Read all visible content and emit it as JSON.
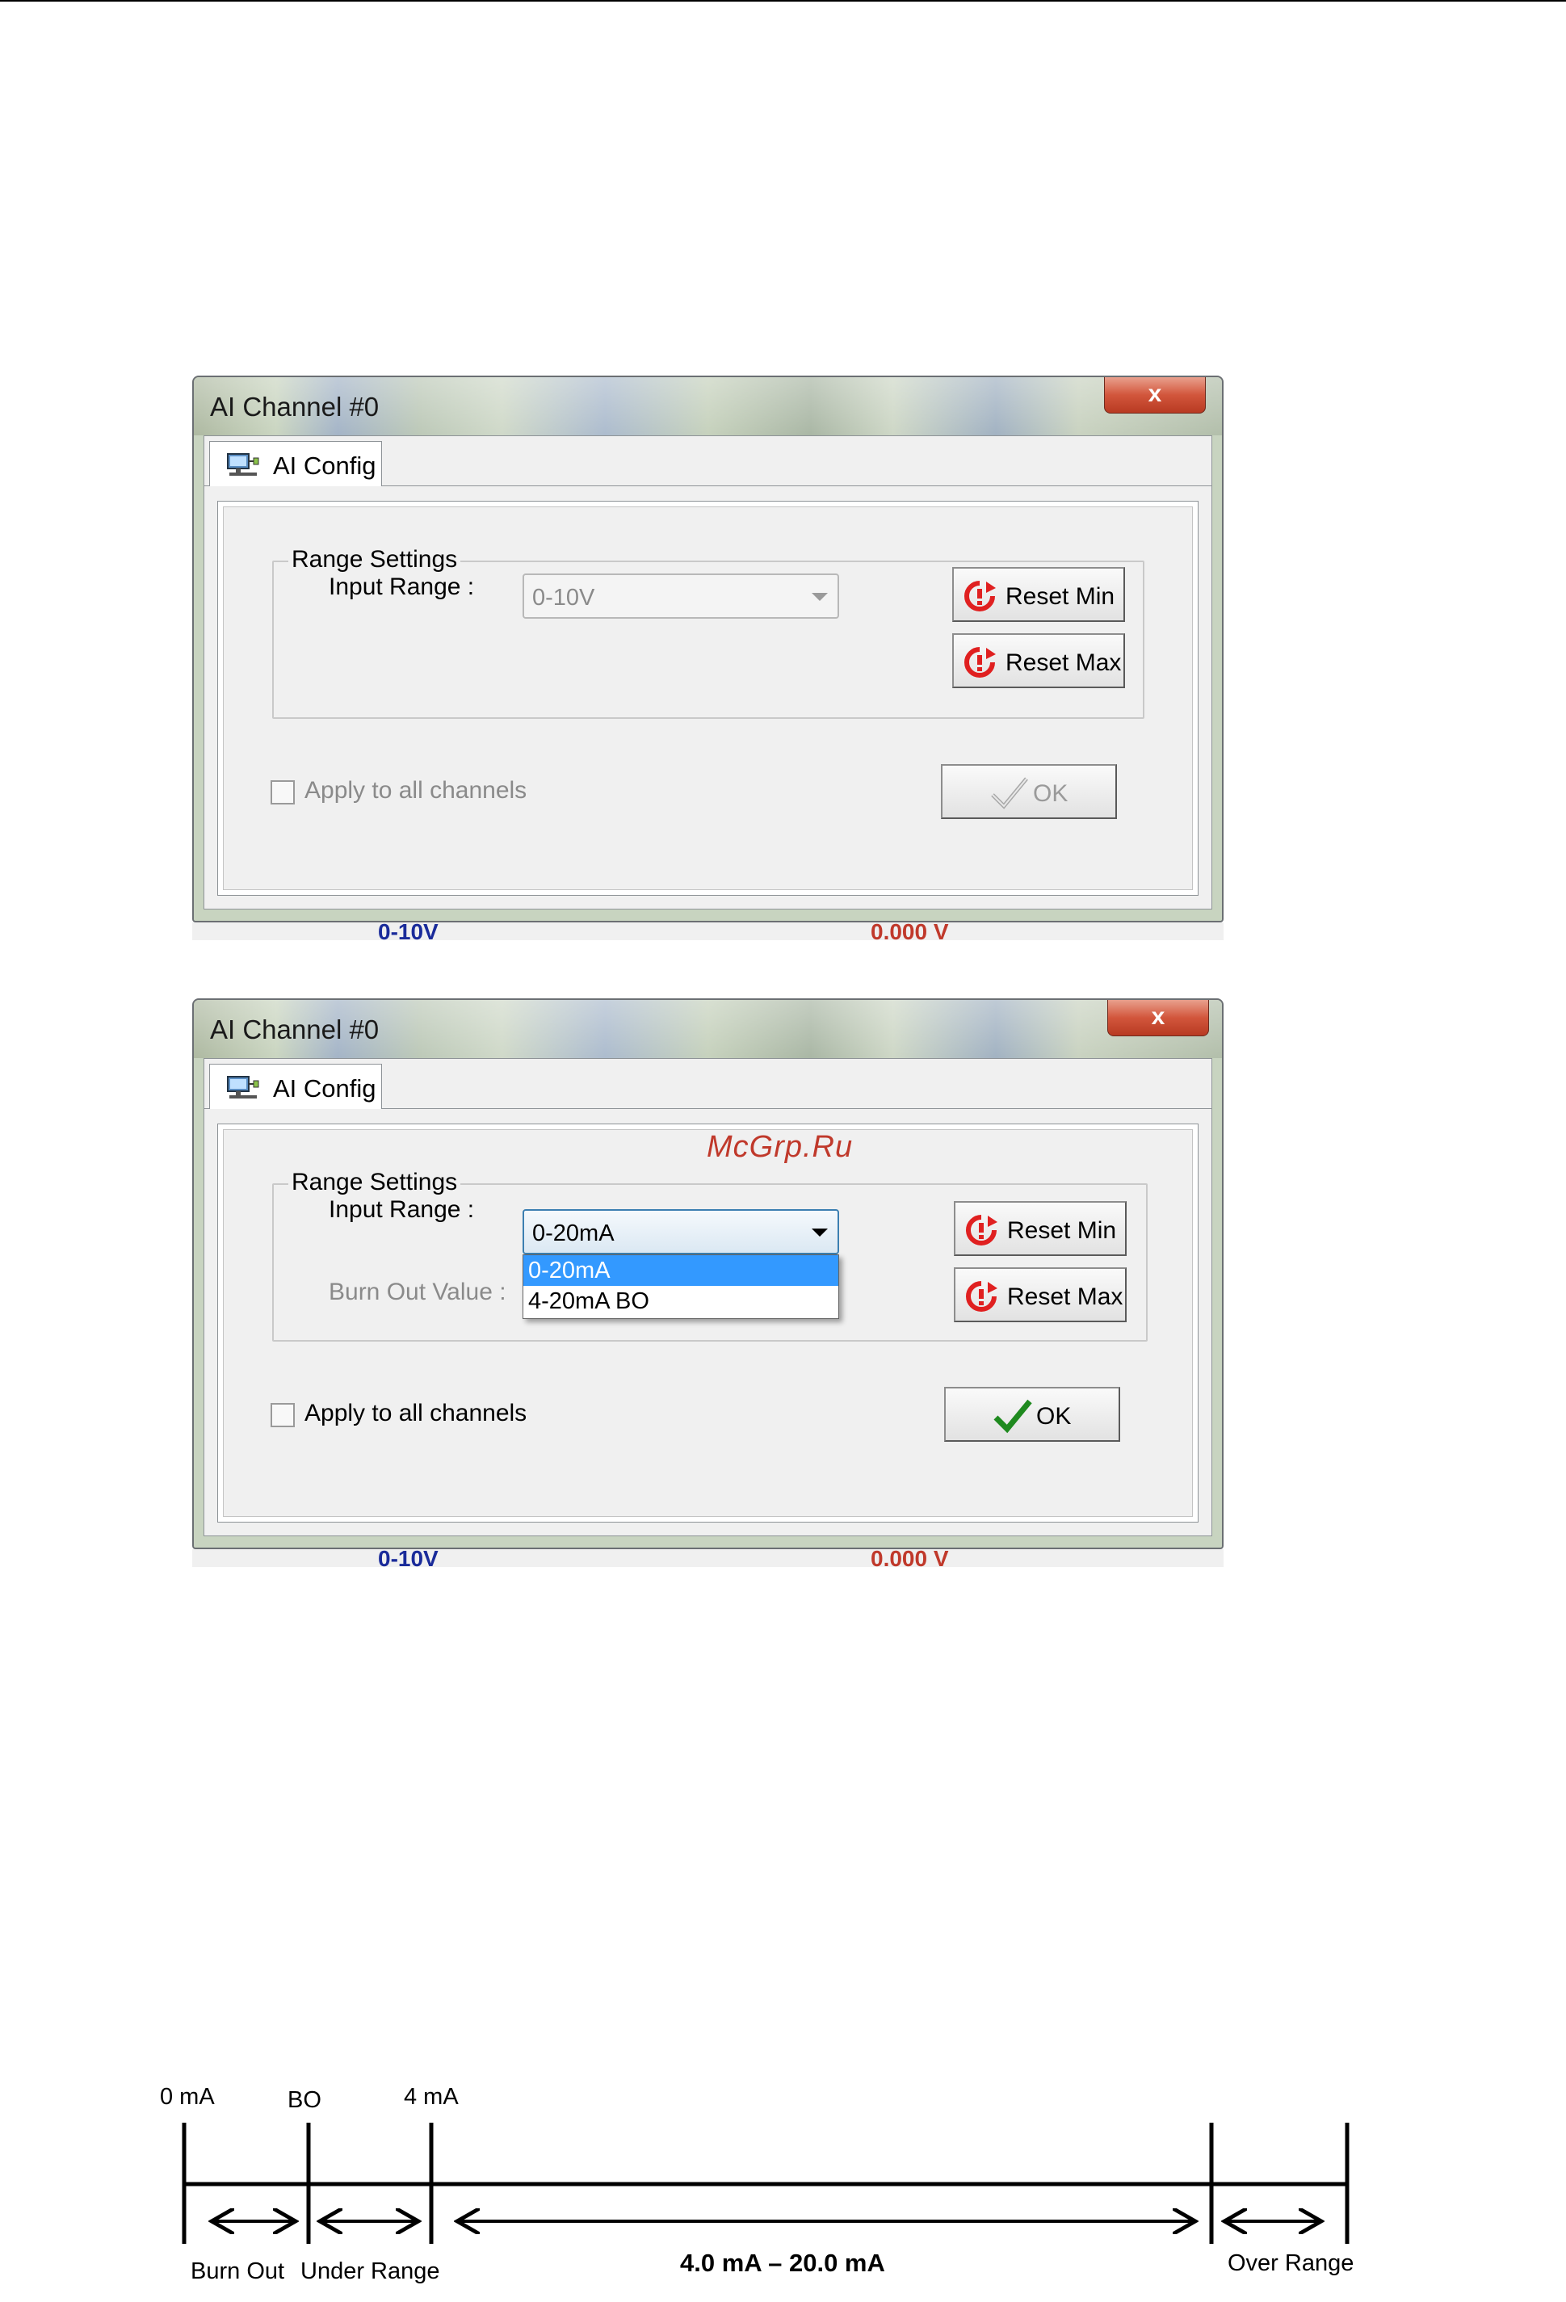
{
  "dialog1": {
    "title": "AI Channel #0",
    "close_glyph": "x",
    "tab_label": "AI Config",
    "group_title": "Range Settings",
    "input_range_label": "Input Range :",
    "input_range_value": "0-10V",
    "reset_min_label": "Reset Min",
    "reset_max_label": "Reset Max",
    "apply_all_label": "Apply to all channels",
    "ok_label": "OK",
    "below_left": "0-10V",
    "below_right": "0.000 V"
  },
  "dialog2": {
    "title": "AI Channel #0",
    "close_glyph": "x",
    "tab_label": "AI Config",
    "group_title": "Range Settings",
    "input_range_label": "Input Range :",
    "input_range_value": "0-20mA",
    "options": [
      "0-20mA",
      "4-20mA BO"
    ],
    "burn_out_label": "Burn Out Value :",
    "reset_min_label": "Reset Min",
    "reset_max_label": "Reset Max",
    "apply_all_label": "Apply to all channels",
    "ok_label": "OK",
    "below_left": "0-10V",
    "below_right": "0.000 V"
  },
  "watermark": "McGrp.Ru",
  "range_diagram": {
    "top_labels": [
      "0 mA",
      "BO",
      "4 mA"
    ],
    "bottom_labels": [
      "Burn Out",
      "Under Range",
      "4.0 mA – 20.0 mA",
      "Over Range"
    ]
  },
  "colors": {
    "accent_blue": "#3399ff",
    "close_red": "#d2563c",
    "reset_icon_red": "#e02020",
    "ok_green": "#1f8a1f",
    "watermark_red": "#c0392b"
  }
}
